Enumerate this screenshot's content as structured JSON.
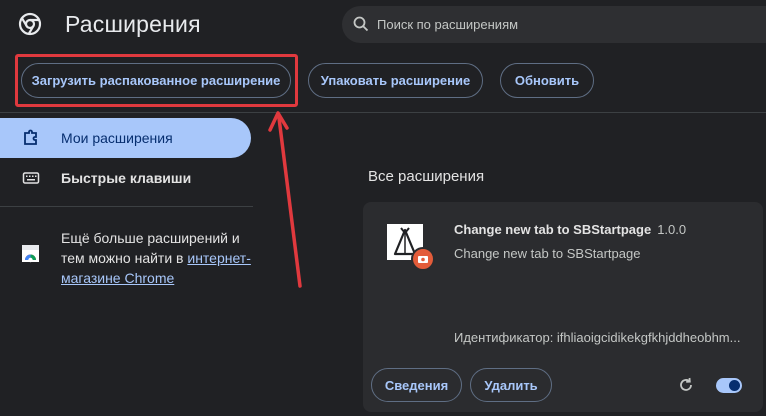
{
  "header": {
    "title": "Расширения",
    "search_placeholder": "Поиск по расширениям"
  },
  "toolbar": {
    "load_unpacked_label": "Загрузить распакованное расширение",
    "pack_label": "Упаковать расширение",
    "update_label": "Обновить"
  },
  "sidebar": {
    "items": [
      {
        "label": "Мои расширения",
        "icon": "puzzle-icon",
        "active": true
      },
      {
        "label": "Быстрые клавиши",
        "icon": "keyboard-icon",
        "active": false
      }
    ],
    "webstore_text": "Ещё больше расширений и тем можно найти в",
    "webstore_link": "интернет-магазине Chrome"
  },
  "main": {
    "section_title": "Все расширения",
    "extensions": [
      {
        "name": "Change new tab to SBStartpage",
        "version": "1.0.0",
        "description": "Change new tab to SBStartpage",
        "id_text": "Идентификатор: ifhliaoigcidikekgfkhjddheobhm...",
        "details_label": "Сведения",
        "remove_label": "Удалить",
        "enabled": true
      }
    ]
  },
  "colors": {
    "background": "#202124",
    "accent": "#a8c7fa",
    "highlight": "#e0393e",
    "card": "#2b2c2f"
  }
}
